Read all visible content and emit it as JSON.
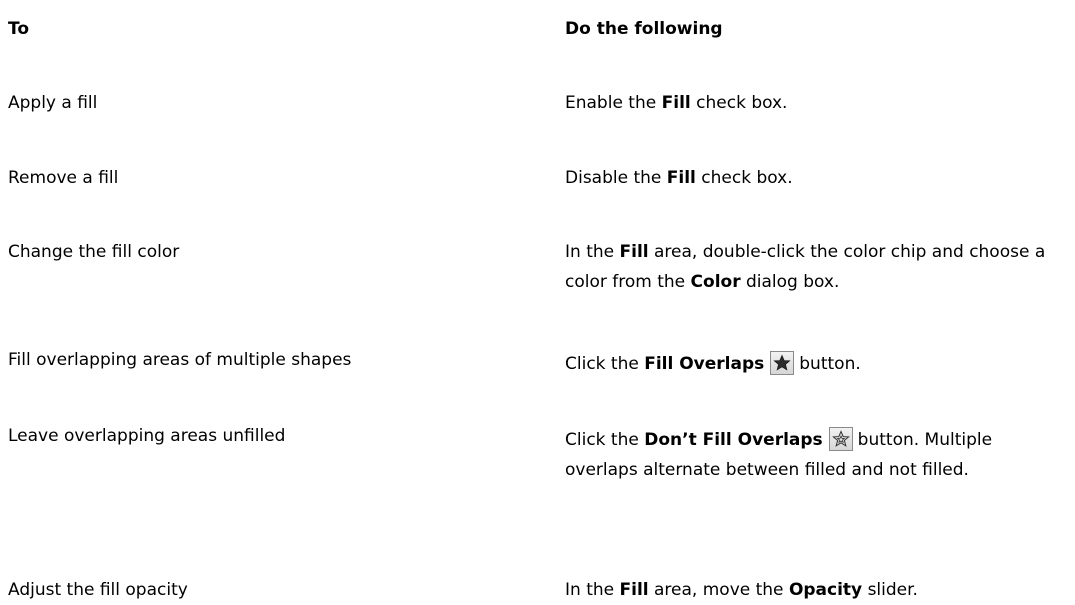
{
  "header": {
    "col_to": "To",
    "col_do": "Do the following"
  },
  "rows": [
    {
      "to": "Apply a fill",
      "do": {
        "a": "Enable the",
        "b": "Fill",
        "c": "check box."
      }
    },
    {
      "to": "Remove a fill",
      "do": {
        "a": "Disable the",
        "b": "Fill",
        "c": "check box."
      }
    },
    {
      "to": "Change the fill color",
      "do": {
        "a": "In the",
        "b": "Fill",
        "c": "area, double-click the color chip and choose a color from the",
        "d": "Color",
        "e": "dialog box."
      }
    },
    {
      "to": "Fill overlapping areas of multiple shapes",
      "do": {
        "a": "Click the",
        "b": "Fill Overlaps",
        "icon": "filled-star-icon",
        "c": "button."
      }
    },
    {
      "to": "Leave overlapping areas unfilled",
      "do": {
        "a": "Click the",
        "b": "Don’t Fill Overlaps",
        "icon": "outline-star-icon",
        "c": "button. Multiple overlaps alternate between filled and not filled."
      }
    },
    {
      "to": "Adjust the fill opacity",
      "do": {
        "a": "In the",
        "b": "Fill",
        "c": "area, move the",
        "d": "Opacity",
        "e": "slider."
      }
    }
  ]
}
